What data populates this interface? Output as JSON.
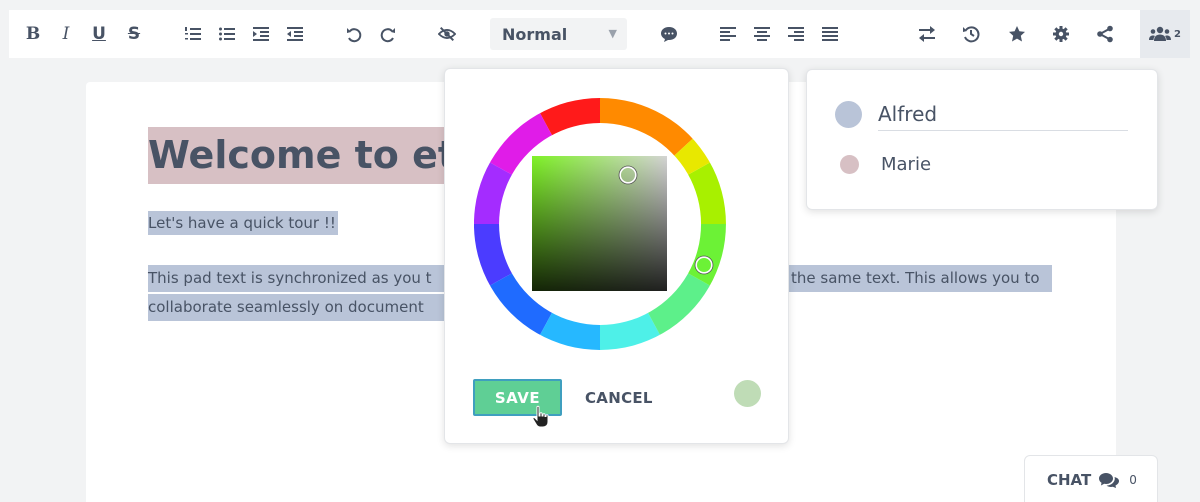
{
  "toolbar": {
    "bold": "B",
    "italic": "I",
    "underline": "U",
    "strike": "S",
    "style_select": "Normal",
    "users_count": "2"
  },
  "document": {
    "heading": "Welcome to et",
    "line1": "Let's have a quick tour !!",
    "para_line1": "This pad text is synchronized as you t",
    "para_line1_right": "the same text. This allows you to",
    "para_line2": "collaborate seamlessly on document"
  },
  "color_picker": {
    "save_label": "SAVE",
    "cancel_label": "CANCEL",
    "selected_color": "#bfdcb6"
  },
  "users": [
    {
      "name": "Alfred",
      "color": "#b9c4d8"
    },
    {
      "name": "Marie",
      "color": "#d7c0c4"
    }
  ],
  "chat": {
    "label": "CHAT",
    "count": "0"
  },
  "colors": {
    "accent_save": "#5fcf95",
    "text": "#485365",
    "highlight_heading": "#d7c0c4",
    "highlight_text": "#b9c4d8"
  }
}
